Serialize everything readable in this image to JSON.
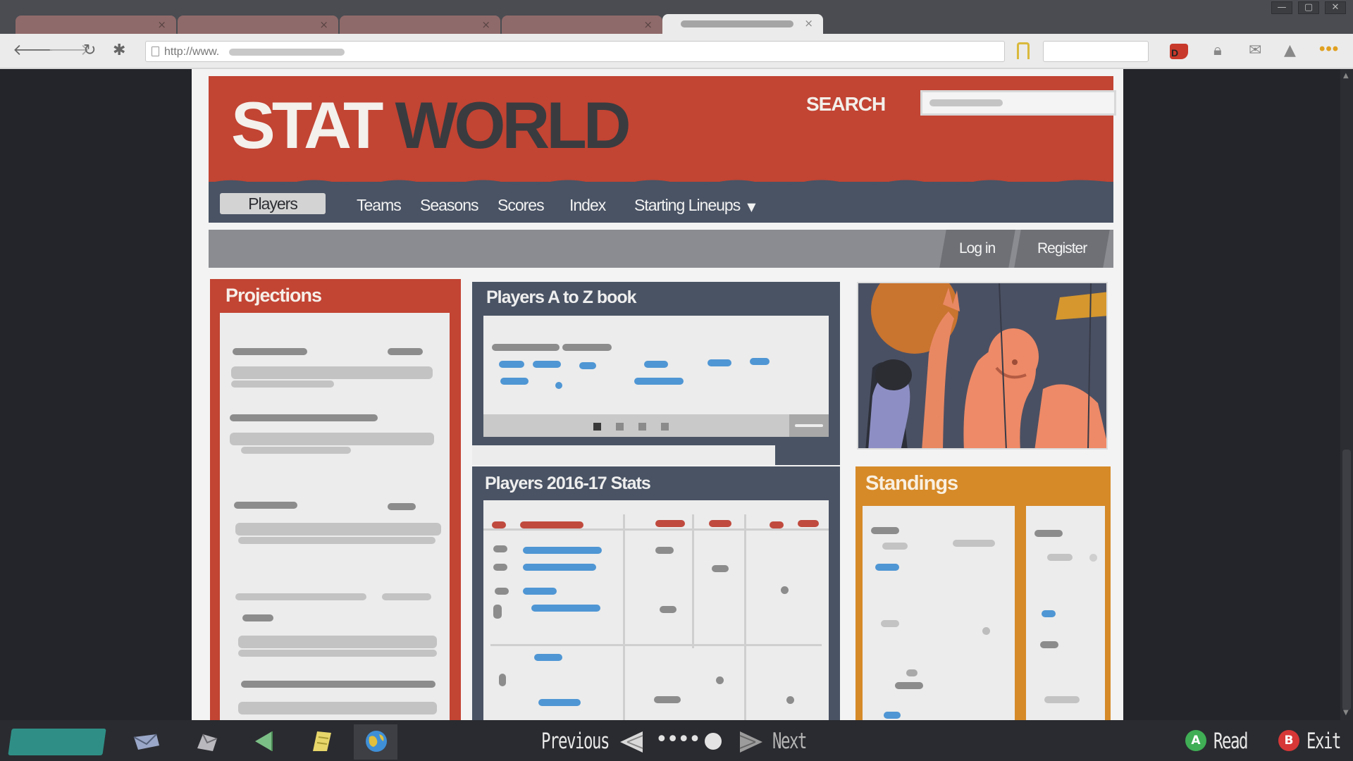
{
  "browser": {
    "tabs": [
      {
        "close": "×"
      },
      {
        "close": "×"
      },
      {
        "close": "×"
      },
      {
        "close": "×"
      },
      {
        "close": "×",
        "active": true
      }
    ],
    "window_controls": {
      "minimize": "—",
      "maximize": "▢",
      "close": "✕"
    },
    "url_prefix": "http://www.",
    "icons": [
      "back-arrow-icon",
      "forward-arrow-icon",
      "reload-icon",
      "settings-gear-icon",
      "bookmark-icon",
      "extension-red-icon",
      "lock-icon",
      "chat-icon",
      "alert-icon",
      "menu-dots-icon"
    ],
    "ext_letter": "D",
    "menu_dots": "•••"
  },
  "site": {
    "logo_part1": "STAT",
    "logo_part2": "WORLD",
    "search_label": "SEARCH",
    "nav": [
      {
        "label": "Players",
        "active": true
      },
      {
        "label": "Teams"
      },
      {
        "label": "Seasons"
      },
      {
        "label": "Scores"
      },
      {
        "label": "Index"
      },
      {
        "label": "Starting Lineups",
        "caret": "▼"
      }
    ],
    "auth": {
      "login": "Log in",
      "register": "Register"
    },
    "panels": {
      "projections": "Projections",
      "azbook": "Players A to Z book",
      "stats": "Players 2016-17 Stats",
      "standings": "Standings"
    },
    "colors": {
      "brand_red": "#c24433",
      "nav_slate": "#495364",
      "standings_orange": "#d68a28",
      "link_blue": "#4f96d4"
    }
  },
  "gamebar": {
    "previous": "Previous",
    "next": "Next",
    "read": "Read",
    "exit": "Exit",
    "read_button": "A",
    "exit_button": "B",
    "page_dots": "••••",
    "icons": [
      "game-logo",
      "mail-icon",
      "pieces-icon",
      "paper-plane-icon",
      "notepad-icon",
      "browser-globe-icon"
    ]
  }
}
